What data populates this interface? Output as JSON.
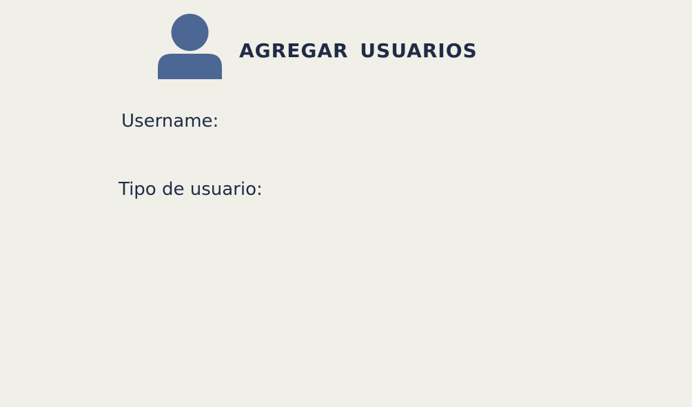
{
  "header": {
    "title": "AGREGAR  USUARIOS",
    "icon": "user-icon"
  },
  "form": {
    "username_label": "Username:",
    "user_type_label": "Tipo de usuario:"
  },
  "colors": {
    "background": "#f0efe8",
    "text": "#1f2c47",
    "icon": "#4d6794"
  }
}
